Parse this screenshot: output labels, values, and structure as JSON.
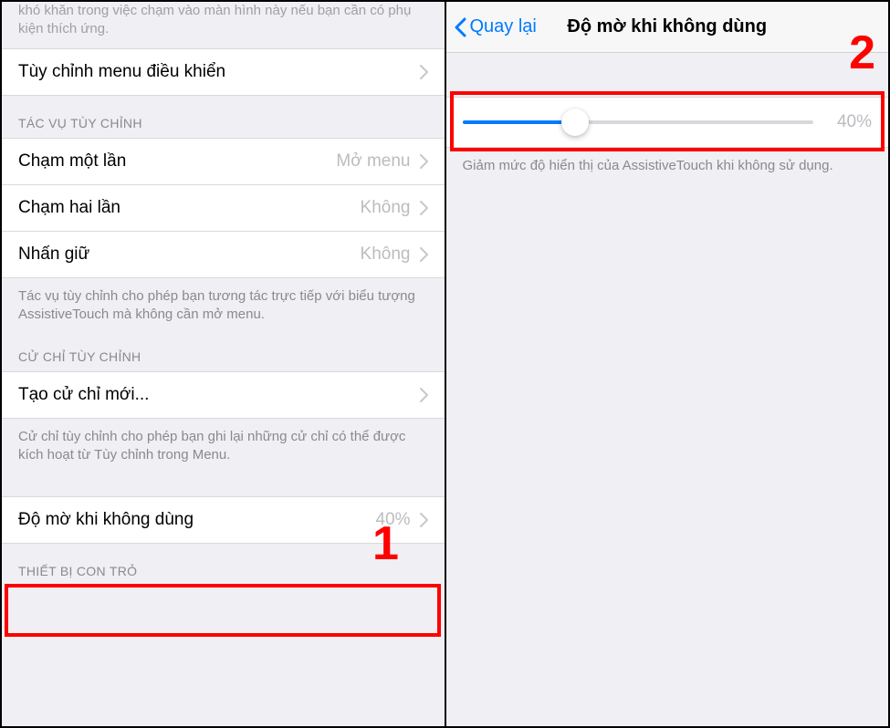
{
  "left": {
    "intro_text": "khó khăn trong việc chạm vào màn hình này nếu bạn cần có phụ kiện thích ứng.",
    "customize_menu": "Tùy chỉnh menu điều khiển",
    "section1_header": "TÁC VỤ TÙY CHỈNH",
    "single_tap": {
      "label": "Chạm một lần",
      "value": "Mở menu"
    },
    "double_tap": {
      "label": "Chạm hai lần",
      "value": "Không"
    },
    "long_press": {
      "label": "Nhấn giữ",
      "value": "Không"
    },
    "section1_footer": "Tác vụ tùy chỉnh cho phép bạn tương tác trực tiếp với biểu tượng AssistiveTouch mà không cần mở menu.",
    "section2_header": "CỬ CHỈ TÙY CHỈNH",
    "create_gesture": "Tạo cử chỉ mới...",
    "section2_footer": "Cử chỉ tùy chỉnh cho phép bạn ghi lại những cử chỉ có thể được kích hoạt từ Tùy chỉnh trong Menu.",
    "idle_opacity": {
      "label": "Độ mờ khi không dùng",
      "value": "40%"
    },
    "section3_header": "THIẾT BỊ CON TRỎ"
  },
  "right": {
    "back_label": "Quay lại",
    "title": "Độ mờ khi không dùng",
    "slider_percent": "40%",
    "slider_value": 32,
    "footer": "Giảm mức độ hiển thị của AssistiveTouch khi không sử dụng."
  },
  "annotations": {
    "num1": "1",
    "num2": "2"
  }
}
